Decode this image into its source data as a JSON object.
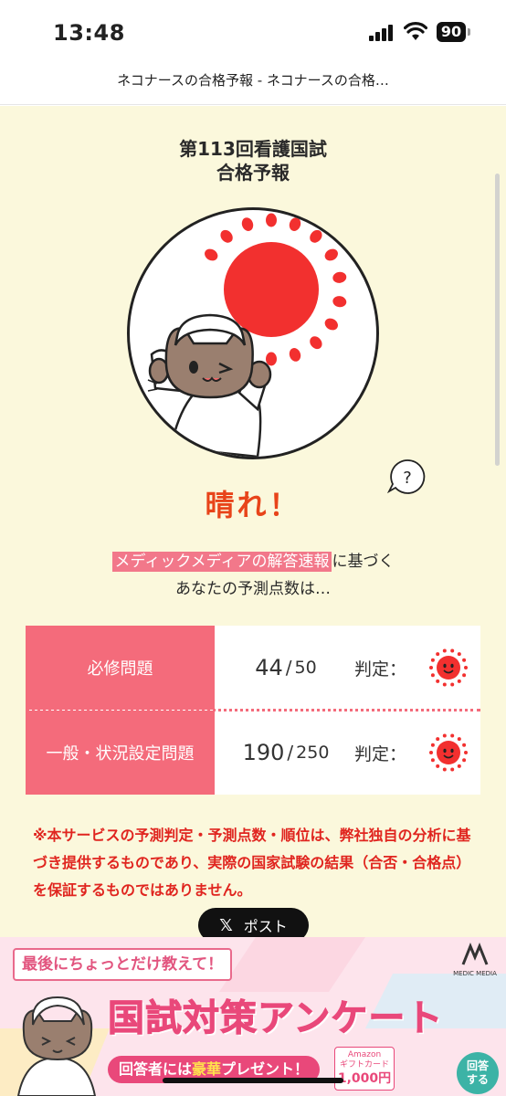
{
  "status": {
    "time": "13:48",
    "battery": "90"
  },
  "browser": {
    "page_title": "ネコナースの合格予報 - ネコナースの合格…"
  },
  "header": {
    "title_line1": "第113回看護国試",
    "title_line2": "合格予報"
  },
  "result": {
    "verdict": "晴れ！",
    "help_label": "?"
  },
  "intro": {
    "highlight": "メディックメディアの解答速報",
    "line1_suffix": "に基づく",
    "line2": "あなたの予測点数は…"
  },
  "scores": [
    {
      "label": "必修問題",
      "score": "44",
      "slash": "/",
      "total": "50",
      "judge_label": "判定："
    },
    {
      "label": "一般・状況設定問題",
      "score": "190",
      "slash": "/",
      "total": "250",
      "judge_label": "判定："
    }
  ],
  "notice": "※本サービスの予測判定・予測点数・順位は、弊社独自の分析に基づき提供するものであり、実際の国家試験の結果（合否・合格点）を保証するものではありません。",
  "share": {
    "x_glyph": "𝕏",
    "label": "ポスト"
  },
  "banner": {
    "top": "最後にちょっとだけ教えて！",
    "main": "国試対策アンケート",
    "sub_pre": "回答者には",
    "sub_gold": "豪華",
    "sub_post": "プレゼント！",
    "amazon_line1": "Amazon",
    "amazon_line2": "ギフトカード",
    "amazon_amount": "1,000円",
    "logo": "MEDIC MEDIA",
    "answer_line1": "回答",
    "answer_line2": "する"
  },
  "colors": {
    "accent_pink": "#f46b7b",
    "sun_red": "#f2302f",
    "verdict_orange": "#e8441a",
    "background": "#fbf8dc"
  },
  "icons": [
    "signal-icon",
    "wifi-icon",
    "battery-icon",
    "sun-icon",
    "cat-nurse-illustration",
    "help-bubble-icon",
    "x-logo-icon"
  ]
}
